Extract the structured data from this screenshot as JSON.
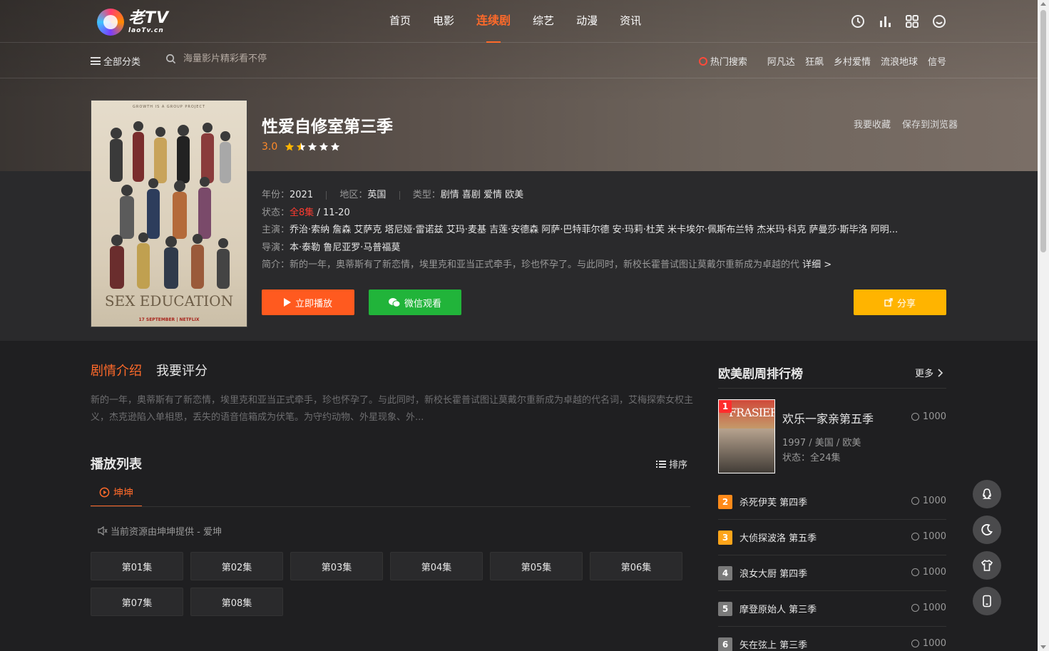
{
  "header": {
    "logo_text": "老TV",
    "logo_domain": "laoTv.cn",
    "nav": [
      "首页",
      "电影",
      "连续剧",
      "综艺",
      "动漫",
      "资讯"
    ],
    "active_nav": "连续剧",
    "icons": [
      "history-icon",
      "chart-icon",
      "grid-icon",
      "smile-icon"
    ]
  },
  "subbar": {
    "all_categories": "全部分类",
    "search_placeholder": "海量影片精彩看不停",
    "hot_label": "热门搜索",
    "hot_links": [
      "阿凡达",
      "狂飙",
      "乡村爱情",
      "流浪地球",
      "信号"
    ]
  },
  "detail": {
    "title": "性爱自修室第三季",
    "score": "3.0",
    "stars_filled": 1.5,
    "favorite": "我要收藏",
    "save_browser": "保存到浏览器",
    "poster_topline": "GROWTH IS A GROUP PROJECT",
    "poster_title": "SEX EDUCATION",
    "poster_sub": "17 SEPTEMBER | NETFLIX",
    "year_label": "年份：",
    "year": "2021",
    "region_label": "地区：",
    "region": "英国",
    "type_label": "类型：",
    "types": "剧情 喜剧 爱情 欧美",
    "status_label": "状态：",
    "status_ep": "全8集",
    "status_date": " / 11-20",
    "cast_label": "主演：",
    "cast": "乔治·索纳 詹森 艾萨克 塔尼娅·雷诺兹 艾玛·麦基 吉莲·安德森 阿萨·巴特菲尔德 安·玛莉·杜芙 米卡埃尔·佩斯布兰特 杰米玛·科克 萨曼莎·斯毕洛 阿明...",
    "director_label": "导演：",
    "director": "本·泰勒 鲁尼亚罗·马普福莫",
    "summary_label": "简介：",
    "summary": "新的一年，奥蒂斯有了新恋情，埃里克和亚当正式牵手，珍也怀孕了。与此同时，新校长霍普试图让莫戴尔重新成为卓越的代",
    "more": "详细 >",
    "play_btn": "立即播放",
    "wechat_btn": "微信观看",
    "share_btn": "分享"
  },
  "content": {
    "tabs": [
      "剧情介绍",
      "我要评分"
    ],
    "description": "新的一年，奥蒂斯有了新恋情，埃里克和亚当正式牵手，珍也怀孕了。与此同时，新校长霍普试图让莫戴尔重新成为卓越的代名词，艾梅探索女权主义，杰克逊陷入单相思，丢失的语音信箱成为伏笔。为守约动物、外星现象、外...",
    "playlist_title": "播放列表",
    "sort": "排序",
    "source": "坤坤",
    "provider": "当前资源由坤坤提供 - 爱坤",
    "episodes": [
      "第01集",
      "第02集",
      "第03集",
      "第04集",
      "第05集",
      "第06集",
      "第07集",
      "第08集"
    ]
  },
  "ranking": {
    "title": "欧美剧周排行榜",
    "more": "更多",
    "first": {
      "num": "1",
      "name": "欢乐一家亲第五季",
      "meta": "1997 / 美国 / 欧美",
      "status": "状态：全24集",
      "views": "1000",
      "cover_title": "FRASIER"
    },
    "items": [
      {
        "num": "2",
        "name": "杀死伊芙 第四季",
        "views": "1000"
      },
      {
        "num": "3",
        "name": "大侦探波洛 第五季",
        "views": "1000"
      },
      {
        "num": "4",
        "name": "浪女大厨 第四季",
        "views": "1000"
      },
      {
        "num": "5",
        "name": "摩登原始人 第三季",
        "views": "1000"
      },
      {
        "num": "6",
        "name": "矢在弦上 第三季",
        "views": "1000"
      }
    ]
  },
  "floating": [
    "qq-icon",
    "moon-icon",
    "shirt-icon",
    "phone-icon"
  ],
  "colors": {
    "accent": "#ff6a2a",
    "play": "#ff5a1f",
    "wechat": "#21b43a",
    "share": "#ffb400"
  }
}
